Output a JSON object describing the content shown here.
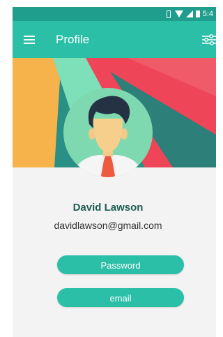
{
  "status_bar": {
    "time": "5:4",
    "icons": [
      "vibrate-icon",
      "wifi-icon",
      "signal-icon",
      "battery-icon"
    ]
  },
  "app_bar": {
    "title": "Profile",
    "menu_icon": "menu-icon",
    "settings_icon": "settings-sliders-icon"
  },
  "profile": {
    "name": "David Lawson",
    "email": "davidlawson@gmail.com"
  },
  "buttons": {
    "password_label": "Password",
    "email_label": "email"
  },
  "colors": {
    "accent": "#2bbfa7",
    "status_bar": "#1f9e8e",
    "name_text": "#1d5e52",
    "art_orange": "#f6b24b",
    "art_mint": "#7de0b8",
    "art_red": "#ee4559"
  }
}
